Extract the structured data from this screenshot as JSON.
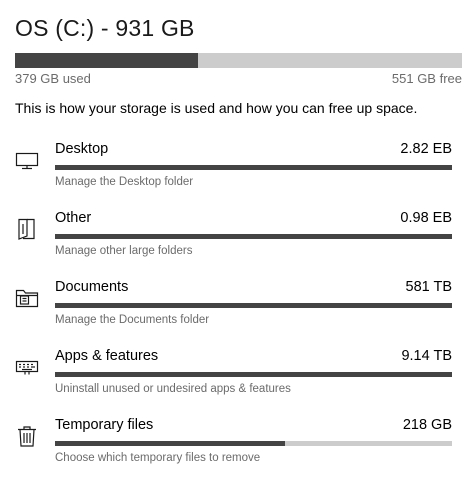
{
  "drive": {
    "title": "OS (C:) - 931 GB",
    "used_label": "379 GB used",
    "free_label": "551 GB free",
    "used_fraction": 0.41
  },
  "description": "This is how your storage is used and how you can free up space.",
  "categories": [
    {
      "name": "Desktop",
      "size": "2.82 EB",
      "description": "Manage the Desktop folder",
      "icon": "monitor-icon",
      "fill": 1.0
    },
    {
      "name": "Other",
      "size": "0.98 EB",
      "description": "Manage other large folders",
      "icon": "folder-sheet-icon",
      "fill": 1.0
    },
    {
      "name": "Documents",
      "size": "581 TB",
      "description": "Manage the Documents folder",
      "icon": "documents-folder-icon",
      "fill": 1.0
    },
    {
      "name": "Apps & features",
      "size": "9.14 TB",
      "description": "Uninstall unused or undesired apps & features",
      "icon": "keyboard-icon",
      "fill": 1.0
    },
    {
      "name": "Temporary files",
      "size": "218 GB",
      "description": "Choose which temporary files to remove",
      "icon": "trash-icon",
      "fill": 0.58
    }
  ],
  "colors": {
    "bar_fill": "#444444",
    "bar_track": "#cccccc",
    "secondary_text": "#6b6b6b"
  }
}
